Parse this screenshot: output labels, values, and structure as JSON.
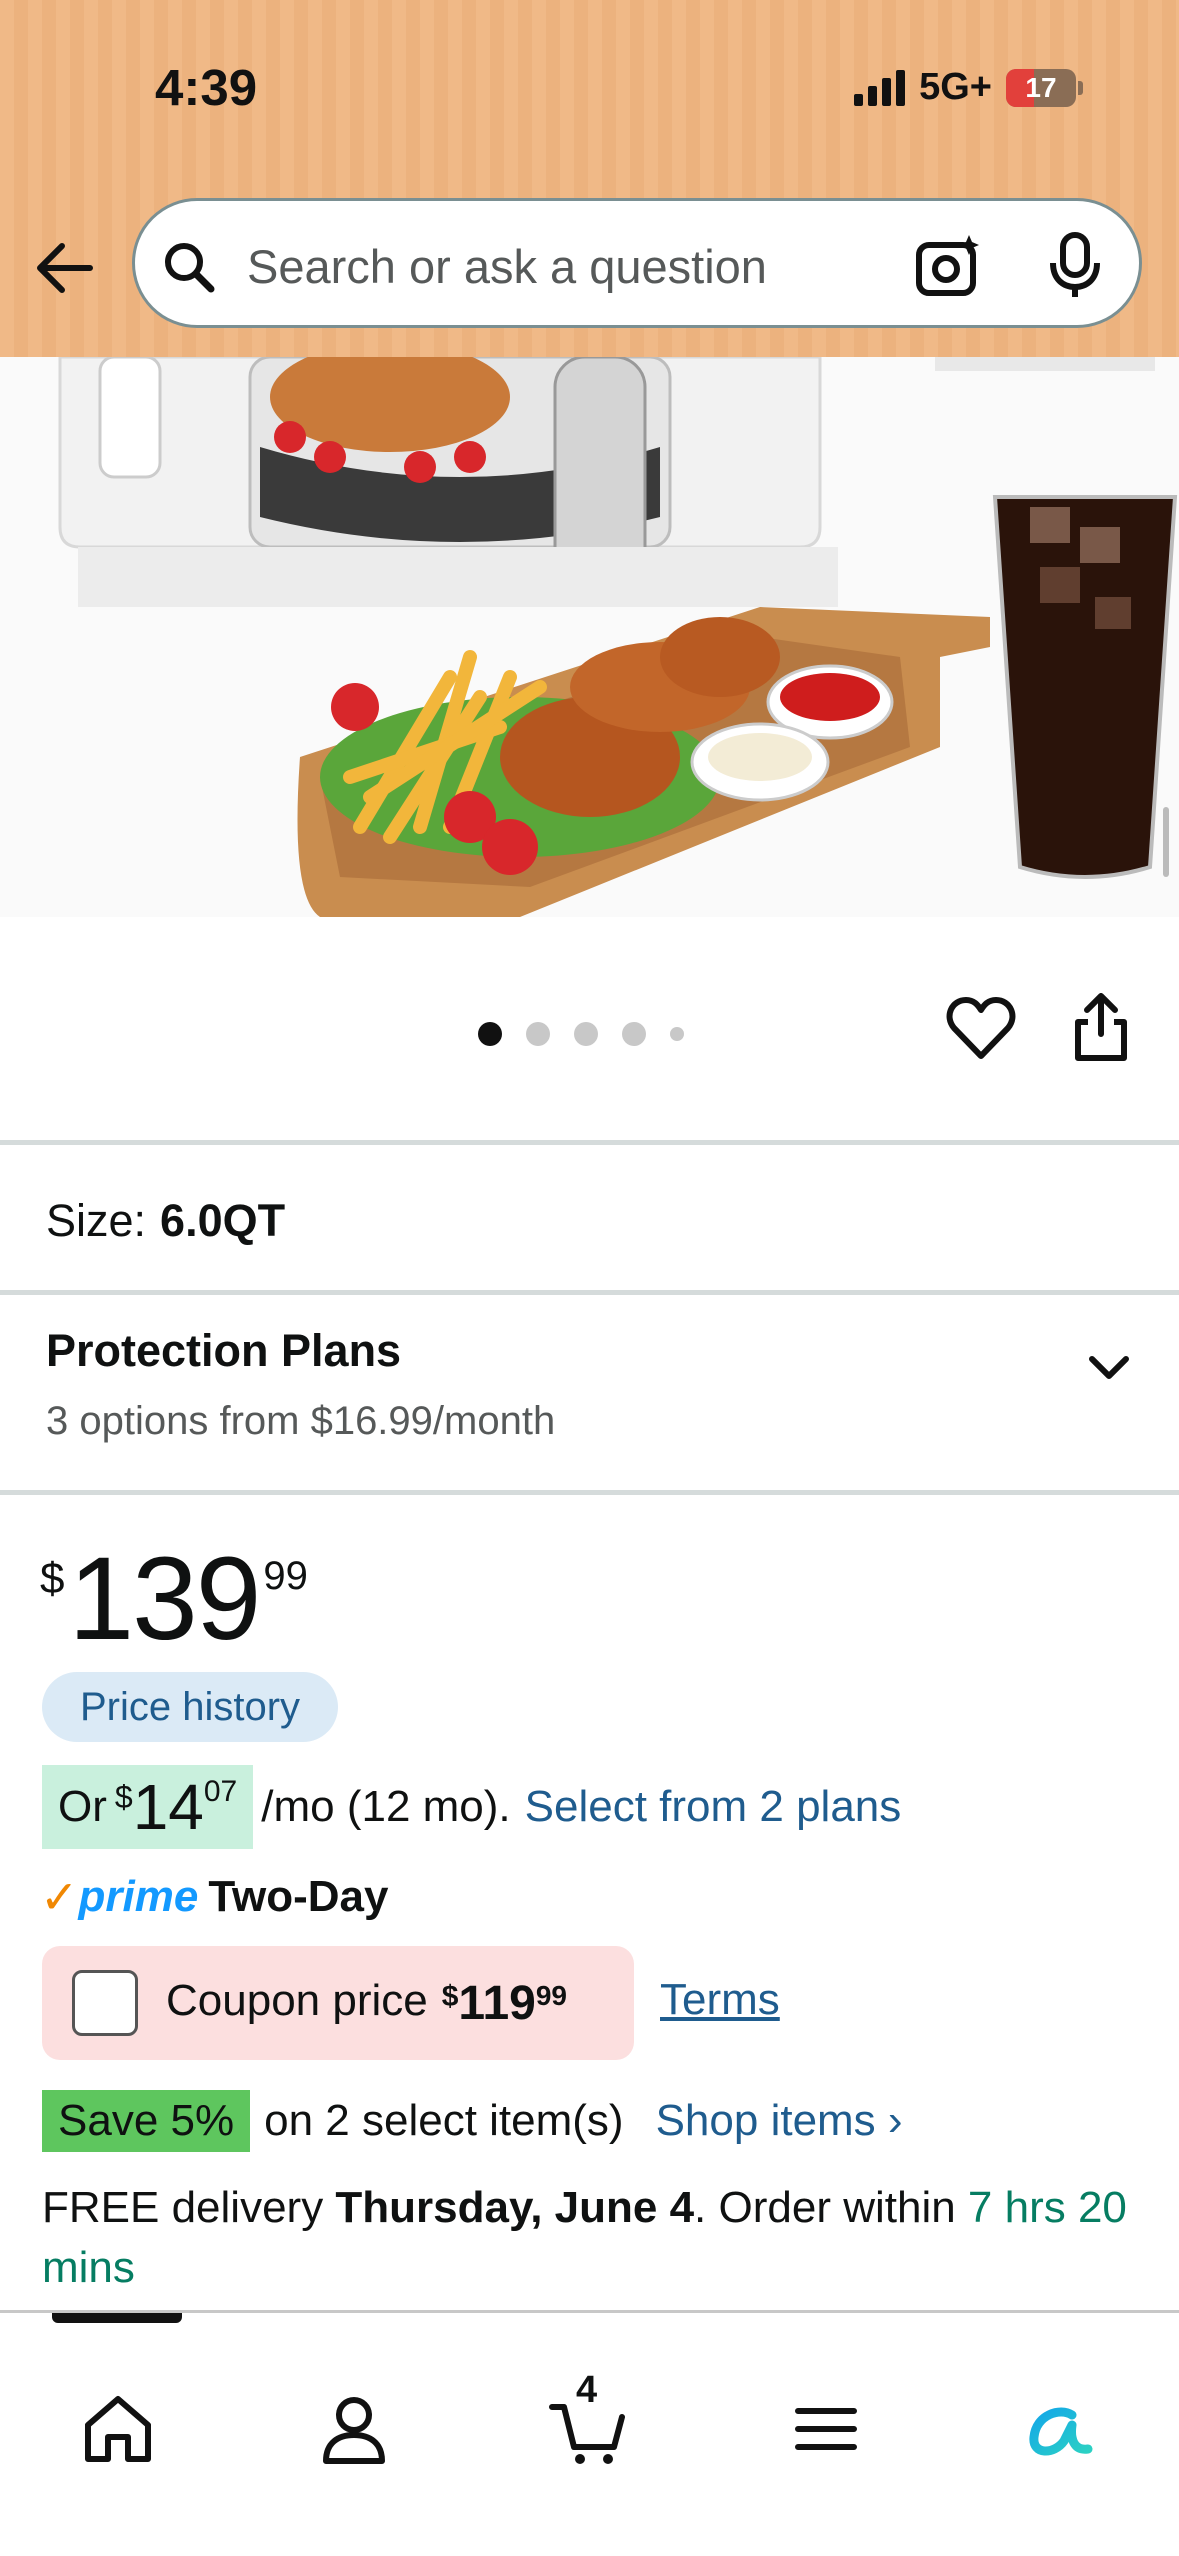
{
  "status_bar": {
    "time": "4:39",
    "network": "5G+",
    "battery": "17"
  },
  "search": {
    "placeholder": "Search or ask a question"
  },
  "carousel": {
    "dot_count": 5,
    "active_index": 0
  },
  "variation": {
    "size_label": "Size:",
    "size_value": "6.0QT"
  },
  "protection": {
    "title": "Protection Plans",
    "subtitle": "3 options from $16.99/month"
  },
  "price": {
    "currency": "$",
    "whole": "139",
    "fraction": "99",
    "history_label": "Price history"
  },
  "installment": {
    "prefix": "Or",
    "currency": "$",
    "whole": "14",
    "fraction": "07",
    "suffix": "/mo (12 mo).",
    "link": "Select from 2 plans"
  },
  "prime": {
    "check": "✓",
    "word": "prime",
    "type": "Two-Day"
  },
  "coupon": {
    "label": "Coupon price",
    "currency": "$",
    "whole": "119",
    "fraction": "99",
    "terms": "Terms"
  },
  "save": {
    "badge": "Save 5%",
    "text": "on 2 select item(s)",
    "link": "Shop items ›"
  },
  "delivery": {
    "prefix": "FREE delivery",
    "date": "Thursday, June 4",
    "middle": ". Order within",
    "time": "7 hrs 20 mins"
  },
  "bottom_nav": {
    "cart_count": "4",
    "accent": "#1399ff"
  },
  "colors": {
    "header": "#f0b987",
    "link": "#1f5c8e",
    "prime_blue": "#1399ff",
    "save_green": "#5ec65e",
    "coupon_bg": "#fcdfdf",
    "installment_bg": "#c9f0dd"
  }
}
